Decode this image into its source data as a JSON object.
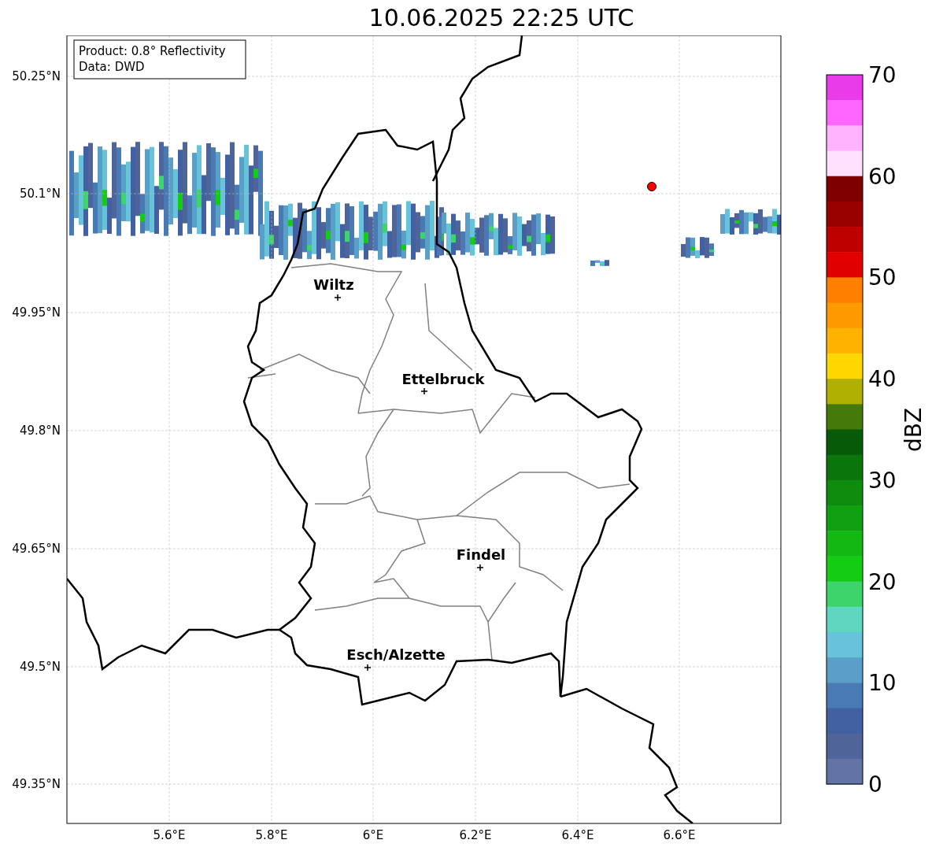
{
  "title": "10.06.2025 22:25 UTC",
  "info_box": [
    "Product: 0.8° Reflectivity",
    "Data: DWD"
  ],
  "map": {
    "y_ticks": [
      "50.25°N",
      "50.1°N",
      "49.95°N",
      "49.8°N",
      "49.65°N",
      "49.5°N",
      "49.35°N"
    ],
    "x_ticks": [
      "5.6°E",
      "5.8°E",
      "6°E",
      "6.2°E",
      "6.4°E",
      "6.6°E"
    ],
    "cities": [
      {
        "name": "Wiltz"
      },
      {
        "name": "Ettelbruck"
      },
      {
        "name": "Findel"
      },
      {
        "name": "Esch/Alzette"
      }
    ]
  },
  "colorbar": {
    "label": "dBZ",
    "ticks": [
      "70",
      "60",
      "50",
      "40",
      "30",
      "20",
      "10",
      "0"
    ],
    "bins": [
      {
        "color": "#e93be9"
      },
      {
        "color": "#ff66ff"
      },
      {
        "color": "#ffb3ff"
      },
      {
        "color": "#ffe0ff"
      },
      {
        "color": "#7f0000"
      },
      {
        "color": "#990000"
      },
      {
        "color": "#bf0000"
      },
      {
        "color": "#e00000"
      },
      {
        "color": "#ff7f00"
      },
      {
        "color": "#ff9900"
      },
      {
        "color": "#ffb300"
      },
      {
        "color": "#ffd700"
      },
      {
        "color": "#b0b000"
      },
      {
        "color": "#457a0a"
      },
      {
        "color": "#075a07"
      },
      {
        "color": "#0a750a"
      },
      {
        "color": "#0d8c0d"
      },
      {
        "color": "#10a010"
      },
      {
        "color": "#13b813"
      },
      {
        "color": "#13cc13"
      },
      {
        "color": "#3dd46b"
      },
      {
        "color": "#5ed6c0"
      },
      {
        "color": "#67c3d9"
      },
      {
        "color": "#5a9fc8"
      },
      {
        "color": "#4a7ab3"
      },
      {
        "color": "#4261a3"
      },
      {
        "color": "#4f6499"
      },
      {
        "color": "#6373a5"
      }
    ]
  }
}
